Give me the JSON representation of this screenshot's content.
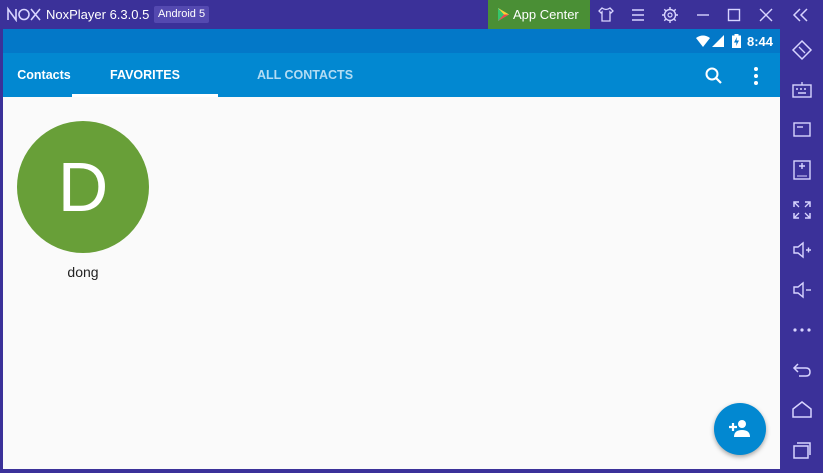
{
  "window": {
    "app_name": "NoxPlayer 6.3.0.5",
    "android_version": "Android 5",
    "app_center_label": "App Center",
    "titlebar_icons": [
      "shirt-icon",
      "menu-icon",
      "settings-gear-icon",
      "minimize-icon",
      "maximize-icon",
      "close-icon",
      "collapse-sidebar-icon"
    ]
  },
  "statusbar": {
    "time": "8:44",
    "icons": [
      "wifi-icon",
      "cell-signal-icon",
      "battery-charging-icon"
    ]
  },
  "appbar": {
    "title": "Contacts",
    "tabs": [
      {
        "label": "FAVORITES",
        "selected": true
      },
      {
        "label": "ALL CONTACTS",
        "selected": false
      }
    ],
    "actions": [
      "search-icon",
      "more-vert-icon"
    ]
  },
  "favorites": [
    {
      "initial": "D",
      "name": "dong",
      "avatar_color": "#689f38"
    }
  ],
  "fab": {
    "icon": "add-contact-icon"
  },
  "sidebar": {
    "icons": [
      "rotate-icon",
      "keyboard-icon",
      "screen-icon",
      "install-apk-icon",
      "fullscreen-icon",
      "volume-up-icon",
      "volume-down-icon",
      "more-icon",
      "back-icon",
      "home-icon",
      "recent-apps-icon"
    ]
  },
  "colors": {
    "frame": "#3b3199",
    "appbar": "#0288d1",
    "statusbar": "#0378c8",
    "app_center": "#4a8f35"
  }
}
